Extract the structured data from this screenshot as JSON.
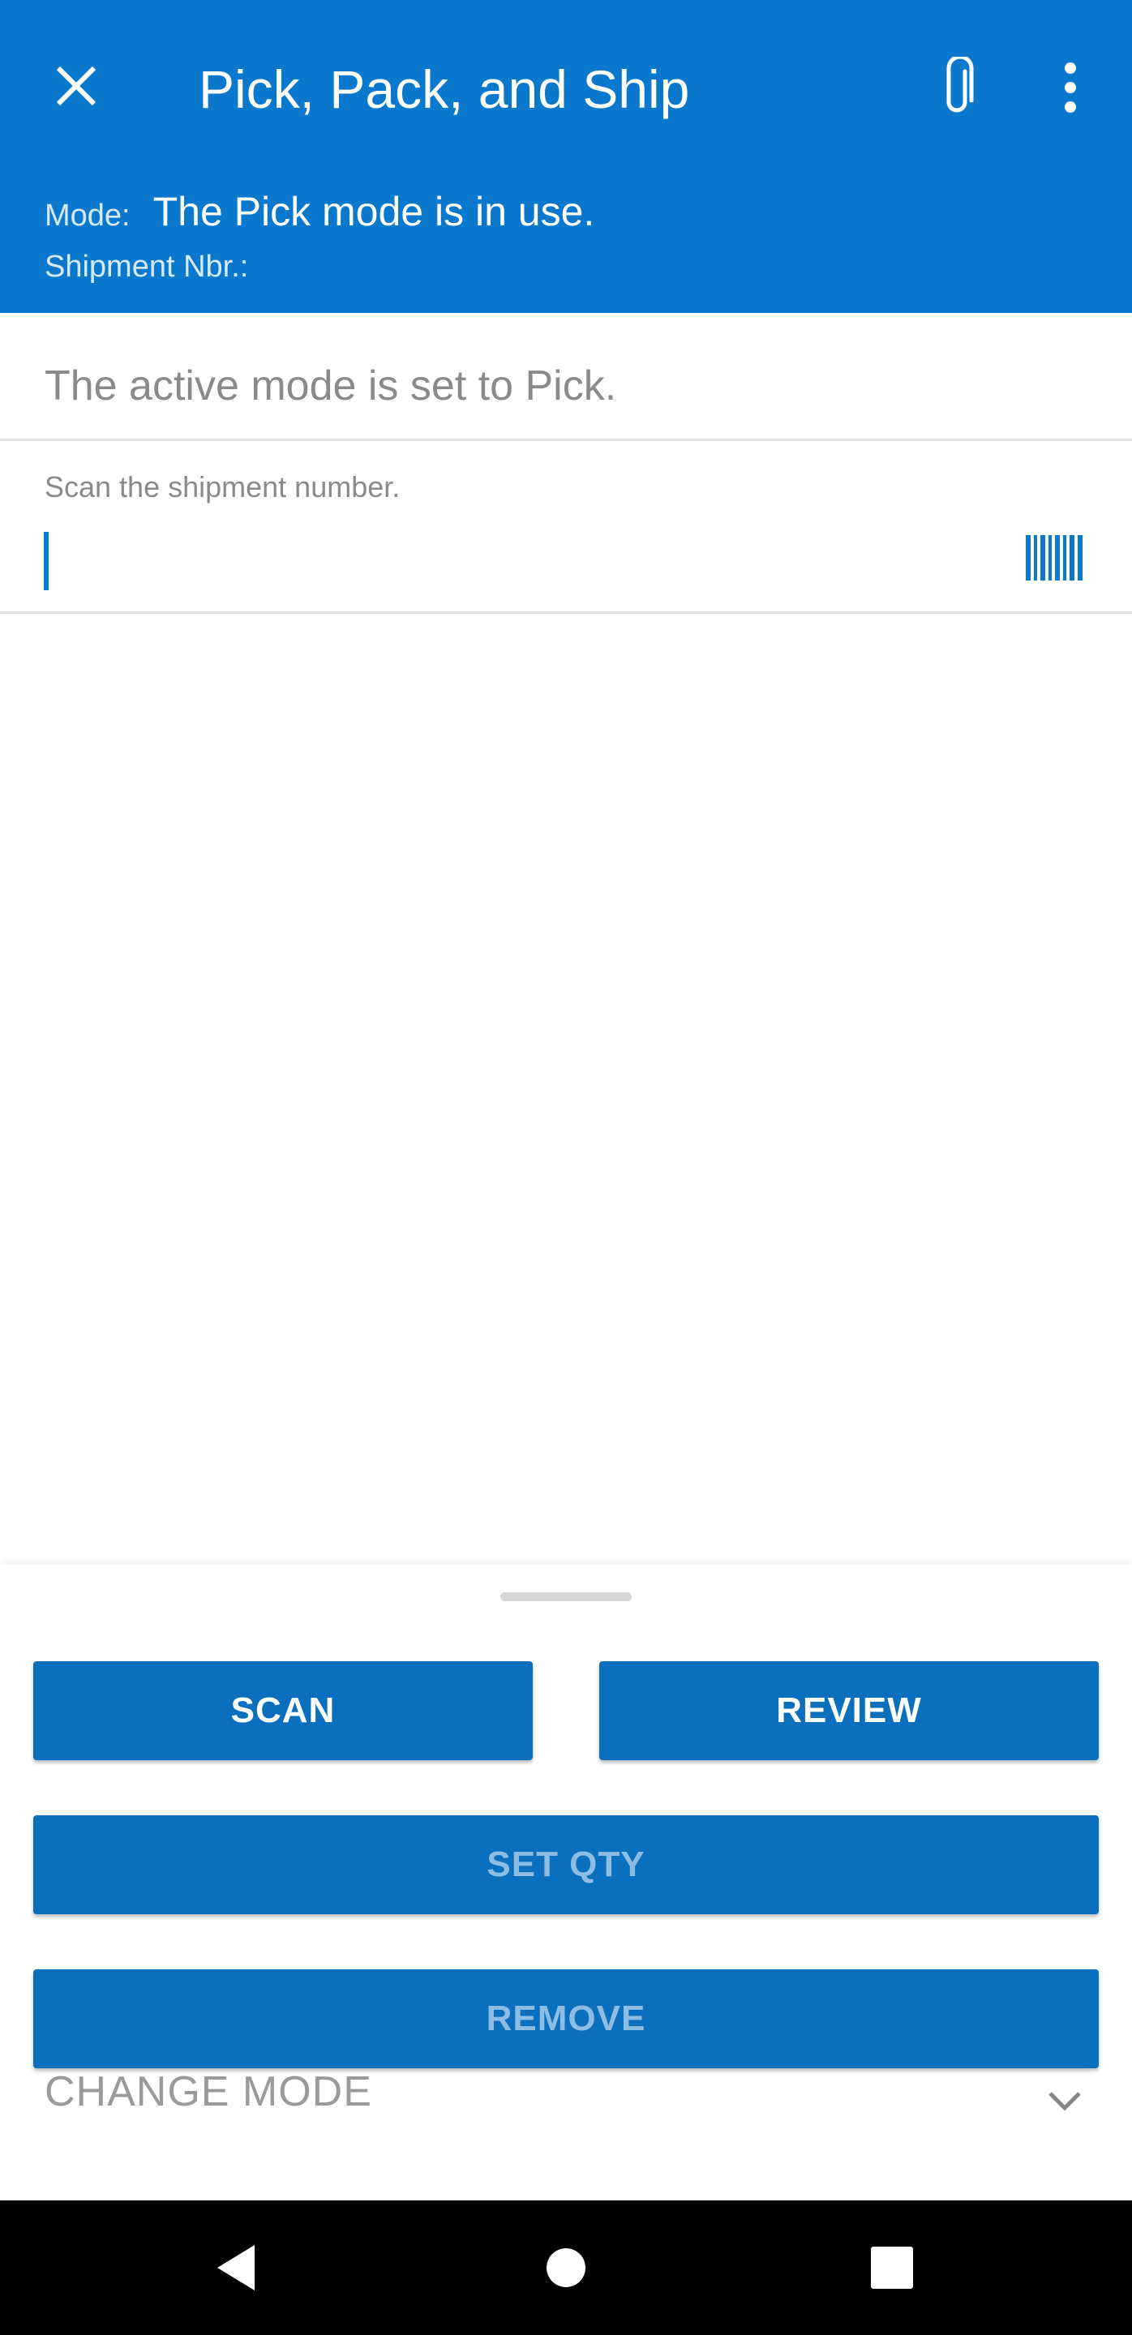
{
  "app": {
    "title": "Pick, Pack, and Ship",
    "icons": {
      "close": "close-icon",
      "attachment": "paperclip-icon",
      "more": "more-vert-icon",
      "barcode": "barcode-icon",
      "chevron": "chevron-down-icon"
    },
    "colors": {
      "primary": "#0a78cc",
      "button": "#0a6fbd",
      "disabled_text": "#8dbde3"
    }
  },
  "header": {
    "mode_label": "Mode:",
    "mode_value": "The Pick mode is in use.",
    "shipment_label": "Shipment Nbr.:"
  },
  "main": {
    "active_mode_message": "The active mode is set to Pick.",
    "scan_prompt": "Scan the shipment number.",
    "scan_value": ""
  },
  "actions": {
    "scan": "SCAN",
    "review": "REVIEW",
    "set_qty": "SET QTY",
    "remove": "REMOVE",
    "change_mode": "CHANGE MODE"
  },
  "navbar": {
    "back": "back-icon",
    "home": "home-icon",
    "recents": "recents-icon"
  }
}
